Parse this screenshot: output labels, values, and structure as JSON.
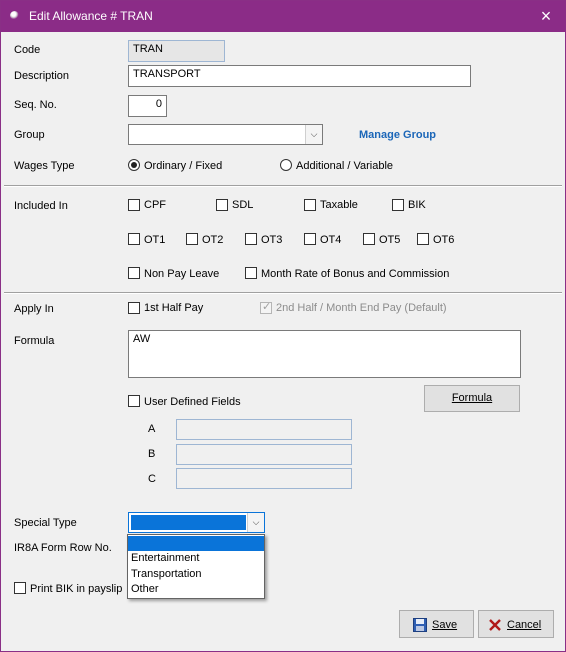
{
  "window": {
    "title": "Edit Allowance # TRAN",
    "close_icon": "×"
  },
  "fields": {
    "code_label": "Code",
    "code_value": "TRAN",
    "description_label": "Description",
    "description_value": "TRANSPORT",
    "seq_label": "Seq. No.",
    "seq_value": "0",
    "group_label": "Group",
    "group_value": "",
    "manage_group_link": "Manage Group",
    "wages_type_label": "Wages Type",
    "wages_type_options": [
      {
        "label": "Ordinary / Fixed",
        "selected": true
      },
      {
        "label": "Additional / Variable",
        "selected": false
      }
    ]
  },
  "included_in": {
    "label": "Included In",
    "row1": [
      "CPF",
      "SDL",
      "Taxable",
      "BIK"
    ],
    "row2": [
      "OT1",
      "OT2",
      "OT3",
      "OT4",
      "OT5",
      "OT6"
    ],
    "row3": [
      "Non Pay Leave",
      "Month Rate of Bonus and Commission"
    ]
  },
  "apply_in": {
    "label": "Apply In",
    "first_half": "1st Half Pay",
    "second_half": "2nd Half / Month End Pay (Default)"
  },
  "formula": {
    "label": "Formula",
    "value": "AW",
    "button": "Formula",
    "user_defined_label": "User Defined Fields",
    "udf_labels": [
      "A",
      "B",
      "C"
    ]
  },
  "special": {
    "label": "Special Type",
    "selected": "",
    "options": [
      "",
      "Entertainment",
      "Transportation",
      "Other"
    ]
  },
  "ir8a_label": "IR8A Form Row No.",
  "print_bik_label": "Print BIK in payslip",
  "buttons": {
    "save": "Save",
    "cancel": "Cancel"
  },
  "colors": {
    "titlebar": "#8b2c87",
    "link": "#1b66b8",
    "selection": "#0a74d9"
  }
}
